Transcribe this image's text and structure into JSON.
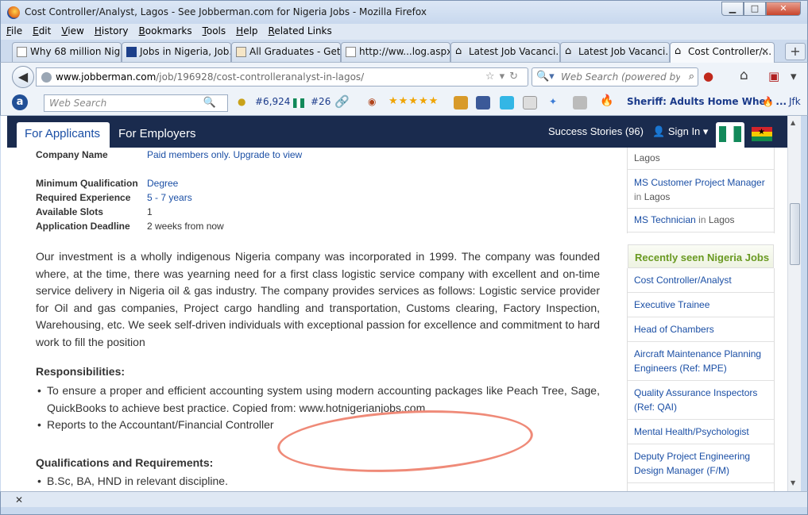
{
  "window": {
    "title": "Cost Controller/Analyst, Lagos - See Jobberman.com for Nigeria Jobs - Mozilla Firefox",
    "buttons": {
      "minimize": "▁",
      "maximize": "□",
      "close": "✕"
    }
  },
  "menu": [
    "File",
    "Edit",
    "View",
    "History",
    "Bookmarks",
    "Tools",
    "Help",
    "Related Links"
  ],
  "tabs": [
    {
      "label": "Why 68 million Nig..."
    },
    {
      "label": "Jobs in Nigeria, Job..."
    },
    {
      "label": "All Graduates - Get..."
    },
    {
      "label": "http://ww...log.aspx"
    },
    {
      "label": "Latest Job Vacanci..."
    },
    {
      "label": "Latest Job Vacanci..."
    },
    {
      "label": "Cost Controller/...",
      "close": "✕"
    }
  ],
  "new_tab": "+",
  "nav": {
    "back": "◀",
    "url_host": "www.jobberman.com",
    "url_path": "/job/196928/cost-controlleranalyst-in-lagos/",
    "url_tools": "☆▾↻",
    "search_placeholder": "Web Search (powered by Goo",
    "icons": {
      "home": "⌂",
      "stop": "●",
      "menu": "▾"
    }
  },
  "toolbar2": {
    "a_logo": "a",
    "search_placeholder": "Web Search",
    "rank1": "#6,924",
    "rank2": "#26",
    "stars": "★★★★★",
    "sheriff": "Sheriff: Adults Home When ...",
    "jfk": "Jfk"
  },
  "site": {
    "tab_applicants": "For Applicants",
    "tab_employers": "For Employers",
    "success_stories": "Success Stories (96)",
    "sign_in": "Sign In ▾",
    "gh_star": "★"
  },
  "details": [
    {
      "label": "Company Name",
      "value": "Paid members only. Upgrade to view",
      "link": true
    },
    {
      "label": "Minimum Qualification",
      "value": "Degree",
      "link": true
    },
    {
      "label": "Required Experience",
      "value": "5 - 7 years",
      "link": true
    },
    {
      "label": "Available Slots",
      "value": "1",
      "link": false
    },
    {
      "label": "Application Deadline",
      "value": "2 weeks from now",
      "link": false
    }
  ],
  "description": "Our investment  is  a wholly indigenous Nigeria company was incorporated in 1999. The company was founded where, at the time, there was yearning need for a first class logistic service company with excellent and on-time service delivery in Nigeria oil & gas industry. The company provides services as follows: Logistic service provider for Oil and gas companies, Project cargo handling and transportation, Customs clearing, Factory Inspection, Warehousing, etc. We seek self-driven individuals with exceptional passion for excellence and commitment to hard work to fill the position",
  "responsibilities": {
    "heading": "Responsibilities:",
    "items": [
      "To ensure a proper and efficient accounting system using modern accounting packages like Peach Tree, Sage, QuickBooks to achieve best practice. Copied from: www.hotnigerianjobs.com",
      "Reports to the Accountant/Financial Controller"
    ]
  },
  "qualifications": {
    "heading": "Qualifications and Requirements:",
    "items": [
      "B.Sc, BA, HND in relevant discipline."
    ]
  },
  "sidebar": {
    "top_items": [
      {
        "title": "",
        "in": "",
        "loc": "Lagos"
      },
      {
        "title": "MS Customer Project Manager",
        "in": "in",
        "loc": "Lagos"
      },
      {
        "title": "MS Technician",
        "in": "in",
        "loc": "Lagos"
      }
    ],
    "recent_heading": "Recently seen Nigeria Jobs",
    "recent_items": [
      "Cost Controller/Analyst",
      "Executive Trainee",
      "Head of Chambers",
      "Aircraft Maintenance Planning Engineers (Ref: MPE)",
      "Quality Assurance Inspectors (Ref: QAI)",
      "Mental Health/Psychologist",
      "Deputy Project Engineering Design Manager (F/M)"
    ]
  },
  "scrollbar": {
    "up": "▲",
    "down": "▼"
  },
  "statusbar": {
    "close": "✕"
  }
}
